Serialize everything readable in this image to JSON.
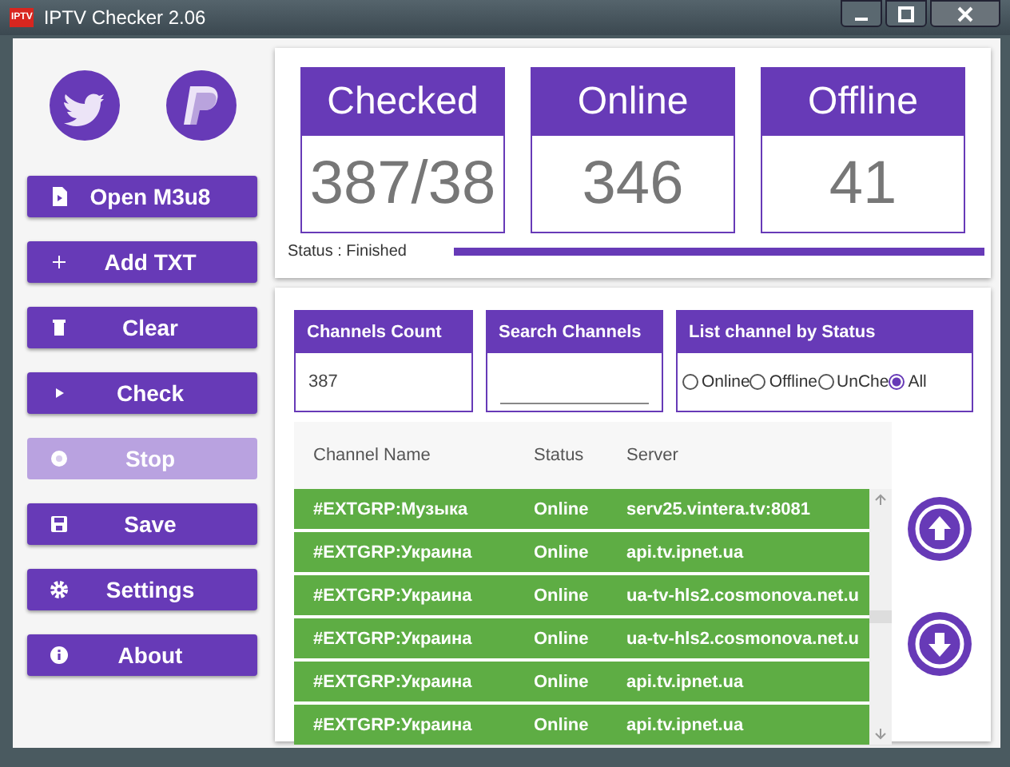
{
  "window": {
    "title": "IPTV Checker 2.06",
    "logo": "IPTV"
  },
  "sidebar": {
    "buttons": [
      {
        "label": "Open M3u8",
        "kind": "file",
        "disabled": false
      },
      {
        "label": "Add TXT",
        "kind": "plus",
        "disabled": false
      },
      {
        "label": "Clear",
        "kind": "trash",
        "disabled": false
      },
      {
        "label": "Check",
        "kind": "play",
        "disabled": false
      },
      {
        "label": "Stop",
        "kind": "stop",
        "disabled": true
      },
      {
        "label": "Save",
        "kind": "save",
        "disabled": false
      },
      {
        "label": "Settings",
        "kind": "gear",
        "disabled": false
      },
      {
        "label": "About",
        "kind": "info",
        "disabled": false
      }
    ]
  },
  "stats": [
    {
      "title": "Checked",
      "value": "387/38"
    },
    {
      "title": "Online",
      "value": "346"
    },
    {
      "title": "Offline",
      "value": "41"
    }
  ],
  "status": {
    "text": "Status : Finished",
    "level": 1
  },
  "channels_count": {
    "title": "Channels Count",
    "value": "387"
  },
  "search": {
    "title": "Search Channels"
  },
  "filter": {
    "title": "List channel by Status",
    "options": [
      {
        "label": "Online",
        "selected": false
      },
      {
        "label": "Offline",
        "selected": false
      },
      {
        "label": "UnChe",
        "selected": false
      },
      {
        "label": "All",
        "selected": true
      }
    ]
  },
  "table": {
    "columns": [
      "Channel Name",
      "Status",
      "Server"
    ],
    "rows": [
      [
        "#EXTGRP:Музыка",
        "Online",
        "serv25.vintera.tv:8081"
      ],
      [
        "#EXTGRP:Украина",
        "Online",
        "api.tv.ipnet.ua"
      ],
      [
        "#EXTGRP:Украина",
        "Online",
        "ua-tv-hls2.cosmonova.net.u"
      ],
      [
        "#EXTGRP:Украина",
        "Online",
        "ua-tv-hls2.cosmonova.net.u"
      ],
      [
        "#EXTGRP:Украина",
        "Online",
        "api.tv.ipnet.ua"
      ],
      [
        "#EXTGRP:Украина",
        "Online",
        "api.tv.ipnet.ua"
      ]
    ]
  }
}
